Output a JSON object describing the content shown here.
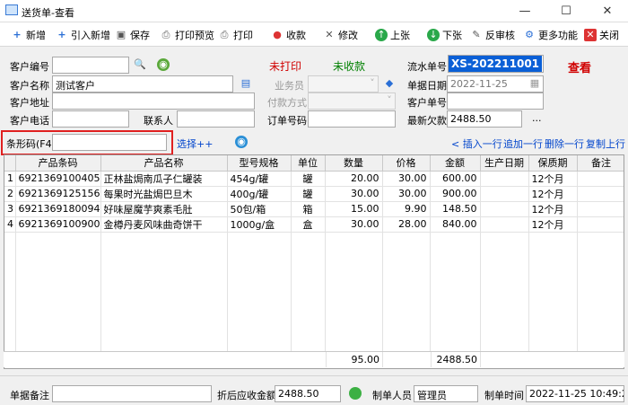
{
  "window": {
    "title": "送货单-查看"
  },
  "toolbar": {
    "new": "新增",
    "import_new": "引入新增",
    "save": "保存",
    "print_preview": "打印预览",
    "print": "打印",
    "collect": "收款",
    "edit": "修改",
    "prev": "上张",
    "next": "下张",
    "unapprove": "反审核",
    "more": "更多功能",
    "close": "关闭"
  },
  "form": {
    "customer_code_label": "客户编号",
    "customer_name_label": "客户名称",
    "customer_name_value": "测试客户",
    "customer_address_label": "客户地址",
    "customer_phone_label": "客户电话",
    "contact_label": "联系人",
    "print_status": "未打印",
    "collect_status": "未收款",
    "salesman_label": "业务员",
    "payment_label": "付款方式",
    "order_no_label": "订单号码",
    "serial_no_label": "流水单号",
    "serial_no_value": "XS-202211001",
    "view_mark": "查看",
    "date_label": "单据日期",
    "date_value": "2022-11-25",
    "customer_doc_label": "客户单号",
    "latest_debt_label": "最新欠款",
    "latest_debt_value": "2488.50",
    "ellipsis": "..."
  },
  "barcode": {
    "label": "条形码(F4)",
    "select_link": "选择++",
    "insert_row": "< 插入一行",
    "add_row": "追加一行",
    "delete_row": "删除一行",
    "copy_row": "复制上行"
  },
  "table": {
    "columns": [
      "",
      "产品条码",
      "产品名称",
      "型号规格",
      "单位",
      "数量",
      "价格",
      "金额",
      "生产日期",
      "保质期",
      "备注"
    ],
    "rows": [
      [
        "1",
        "6921369100405",
        "正林盐焗南瓜子仁罐装",
        "454g/罐",
        "罐",
        "20.00",
        "30.00",
        "600.00",
        "",
        "12个月",
        ""
      ],
      [
        "2",
        "6921369125156",
        "每果时光盐焗巴旦木",
        "400g/罐",
        "罐",
        "30.00",
        "30.00",
        "900.00",
        "",
        "12个月",
        ""
      ],
      [
        "3",
        "6921369180094",
        "好味屋魔芋爽素毛肚",
        "50包/箱",
        "箱",
        "15.00",
        "9.90",
        "148.50",
        "",
        "12个月",
        ""
      ],
      [
        "4",
        "6921369100900",
        "金樽丹麦风味曲奇饼干",
        "1000g/盒",
        "盒",
        "30.00",
        "28.00",
        "840.00",
        "",
        "12个月",
        ""
      ]
    ],
    "total_qty": "95.00",
    "total_amount": "2488.50"
  },
  "footer": {
    "remark_label": "单据备注",
    "receivable_label": "折后应收金额",
    "receivable_value": "2488.50",
    "maker_label": "制单人员",
    "maker_value": "管理员",
    "time_label": "制单时间",
    "time_value": "2022-11-25 10:49:23"
  },
  "icons": [
    "window-icon",
    "new-icon",
    "import-icon",
    "save-icon",
    "print-preview-icon",
    "print-icon",
    "collect-icon",
    "edit-icon",
    "prev-icon",
    "next-icon",
    "unapprove-icon",
    "more-icon",
    "close-icon",
    "lookup-icon",
    "globe-icon",
    "calendar-icon"
  ],
  "colors": {
    "highlight": "#0a5fd6",
    "red": "#d00000",
    "green": "#008000",
    "barcode_border": "#e02020"
  }
}
